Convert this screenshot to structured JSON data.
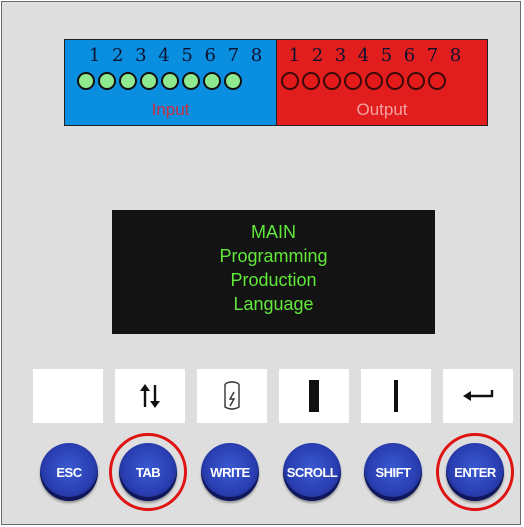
{
  "io_panel": {
    "input": {
      "label": "Input",
      "numbers": [
        "1",
        "2",
        "3",
        "4",
        "5",
        "6",
        "7",
        "8"
      ],
      "led_color": "#8fe98f"
    },
    "output": {
      "label": "Output",
      "numbers": [
        "1",
        "2",
        "3",
        "4",
        "5",
        "6",
        "7",
        "8"
      ],
      "led_color": "#e41a1a"
    }
  },
  "display": {
    "lines": [
      "MAIN",
      "Programming",
      "Production",
      "Language"
    ],
    "text_color": "#62e83a"
  },
  "function_keys": [
    {
      "icon": "blank-icon"
    },
    {
      "icon": "up-down-arrows-icon"
    },
    {
      "icon": "battery-icon"
    },
    {
      "icon": "thick-bar-icon"
    },
    {
      "icon": "thin-bar-icon"
    },
    {
      "icon": "return-arrow-icon"
    }
  ],
  "buttons": [
    {
      "label": "ESC",
      "highlighted": false
    },
    {
      "label": "TAB",
      "highlighted": true
    },
    {
      "label": "WRITE",
      "highlighted": false
    },
    {
      "label": "SCROLL",
      "highlighted": false
    },
    {
      "label": "SHIFT",
      "highlighted": false
    },
    {
      "label": "ENTER",
      "highlighted": true
    }
  ],
  "colors": {
    "highlight_ring": "#e01313",
    "button_blue": "#2a3fb3"
  }
}
